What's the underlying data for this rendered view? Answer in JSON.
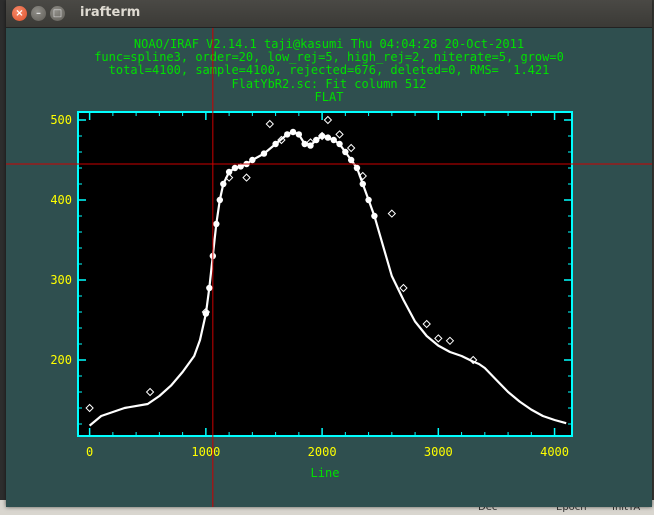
{
  "window": {
    "title": "irafterm",
    "close_glyph": "×",
    "min_glyph": "–",
    "max_glyph": "□"
  },
  "header": {
    "line1": "NOAO/IRAF V2.14.1 taji@kasumi Thu 04:04:28 20-Oct-2011",
    "line2": "func=spline3, order=20, low_rej=5, high_rej=2, niterate=5, grow=0",
    "line3": "total=4100, sample=4100, rejected=676, deleted=0, RMS=  1.421",
    "line4": "FlatYbR2.sc: Fit column 512",
    "line5": "FLAT"
  },
  "background_taskbar": {
    "item1": "Dec",
    "item2": "Epoch",
    "item3": "InitTA"
  },
  "colors": {
    "window_bg": "#2f4f4f",
    "text": "#00e000",
    "axes": "#00ffff",
    "ticklabels": "#ffff00",
    "data": "#ffffff",
    "cursor": "#cc0000"
  },
  "chart_data": {
    "type": "line",
    "xlabel": "Line",
    "ylabel": "",
    "xlim": [
      -100,
      4150
    ],
    "ylim": [
      105,
      510
    ],
    "xticks": [
      0,
      1000,
      2000,
      3000,
      4000
    ],
    "yticks": [
      200,
      300,
      400,
      500
    ],
    "cursor": {
      "x": 1060,
      "y": 445
    },
    "series": [
      {
        "kind": "data",
        "x": [
          0,
          100,
          300,
          500,
          600,
          700,
          800,
          900,
          950,
          1000,
          1030,
          1060,
          1090,
          1120,
          1150,
          1200,
          1250,
          1300,
          1350,
          1400,
          1500,
          1600,
          1700,
          1750,
          1800,
          1850,
          1900,
          1950,
          2000,
          2050,
          2100,
          2150,
          2200,
          2250,
          2300,
          2350,
          2400,
          2450,
          2500,
          2550,
          2600,
          2700,
          2800,
          2900,
          3000,
          3100,
          3200,
          3300,
          3350,
          3400,
          3500,
          3600,
          3700,
          3800,
          3900,
          4000,
          4100
        ],
        "y": [
          118,
          130,
          140,
          145,
          155,
          168,
          185,
          205,
          225,
          258,
          290,
          330,
          370,
          400,
          420,
          435,
          440,
          442,
          445,
          450,
          458,
          470,
          482,
          485,
          482,
          470,
          468,
          475,
          480,
          478,
          475,
          470,
          460,
          450,
          440,
          420,
          400,
          380,
          355,
          330,
          305,
          275,
          248,
          230,
          218,
          210,
          205,
          198,
          195,
          190,
          175,
          160,
          148,
          138,
          130,
          125,
          121
        ]
      },
      {
        "kind": "rejected",
        "x": [
          0,
          520,
          1000,
          1200,
          1350,
          1550,
          1650,
          1900,
          2000,
          2050,
          2150,
          2250,
          2350,
          2600,
          2700,
          2900,
          3000,
          3100,
          3300
        ],
        "y": [
          140,
          160,
          260,
          428,
          428,
          495,
          475,
          472,
          480,
          500,
          482,
          465,
          430,
          383,
          290,
          245,
          227,
          224,
          200
        ]
      }
    ]
  }
}
